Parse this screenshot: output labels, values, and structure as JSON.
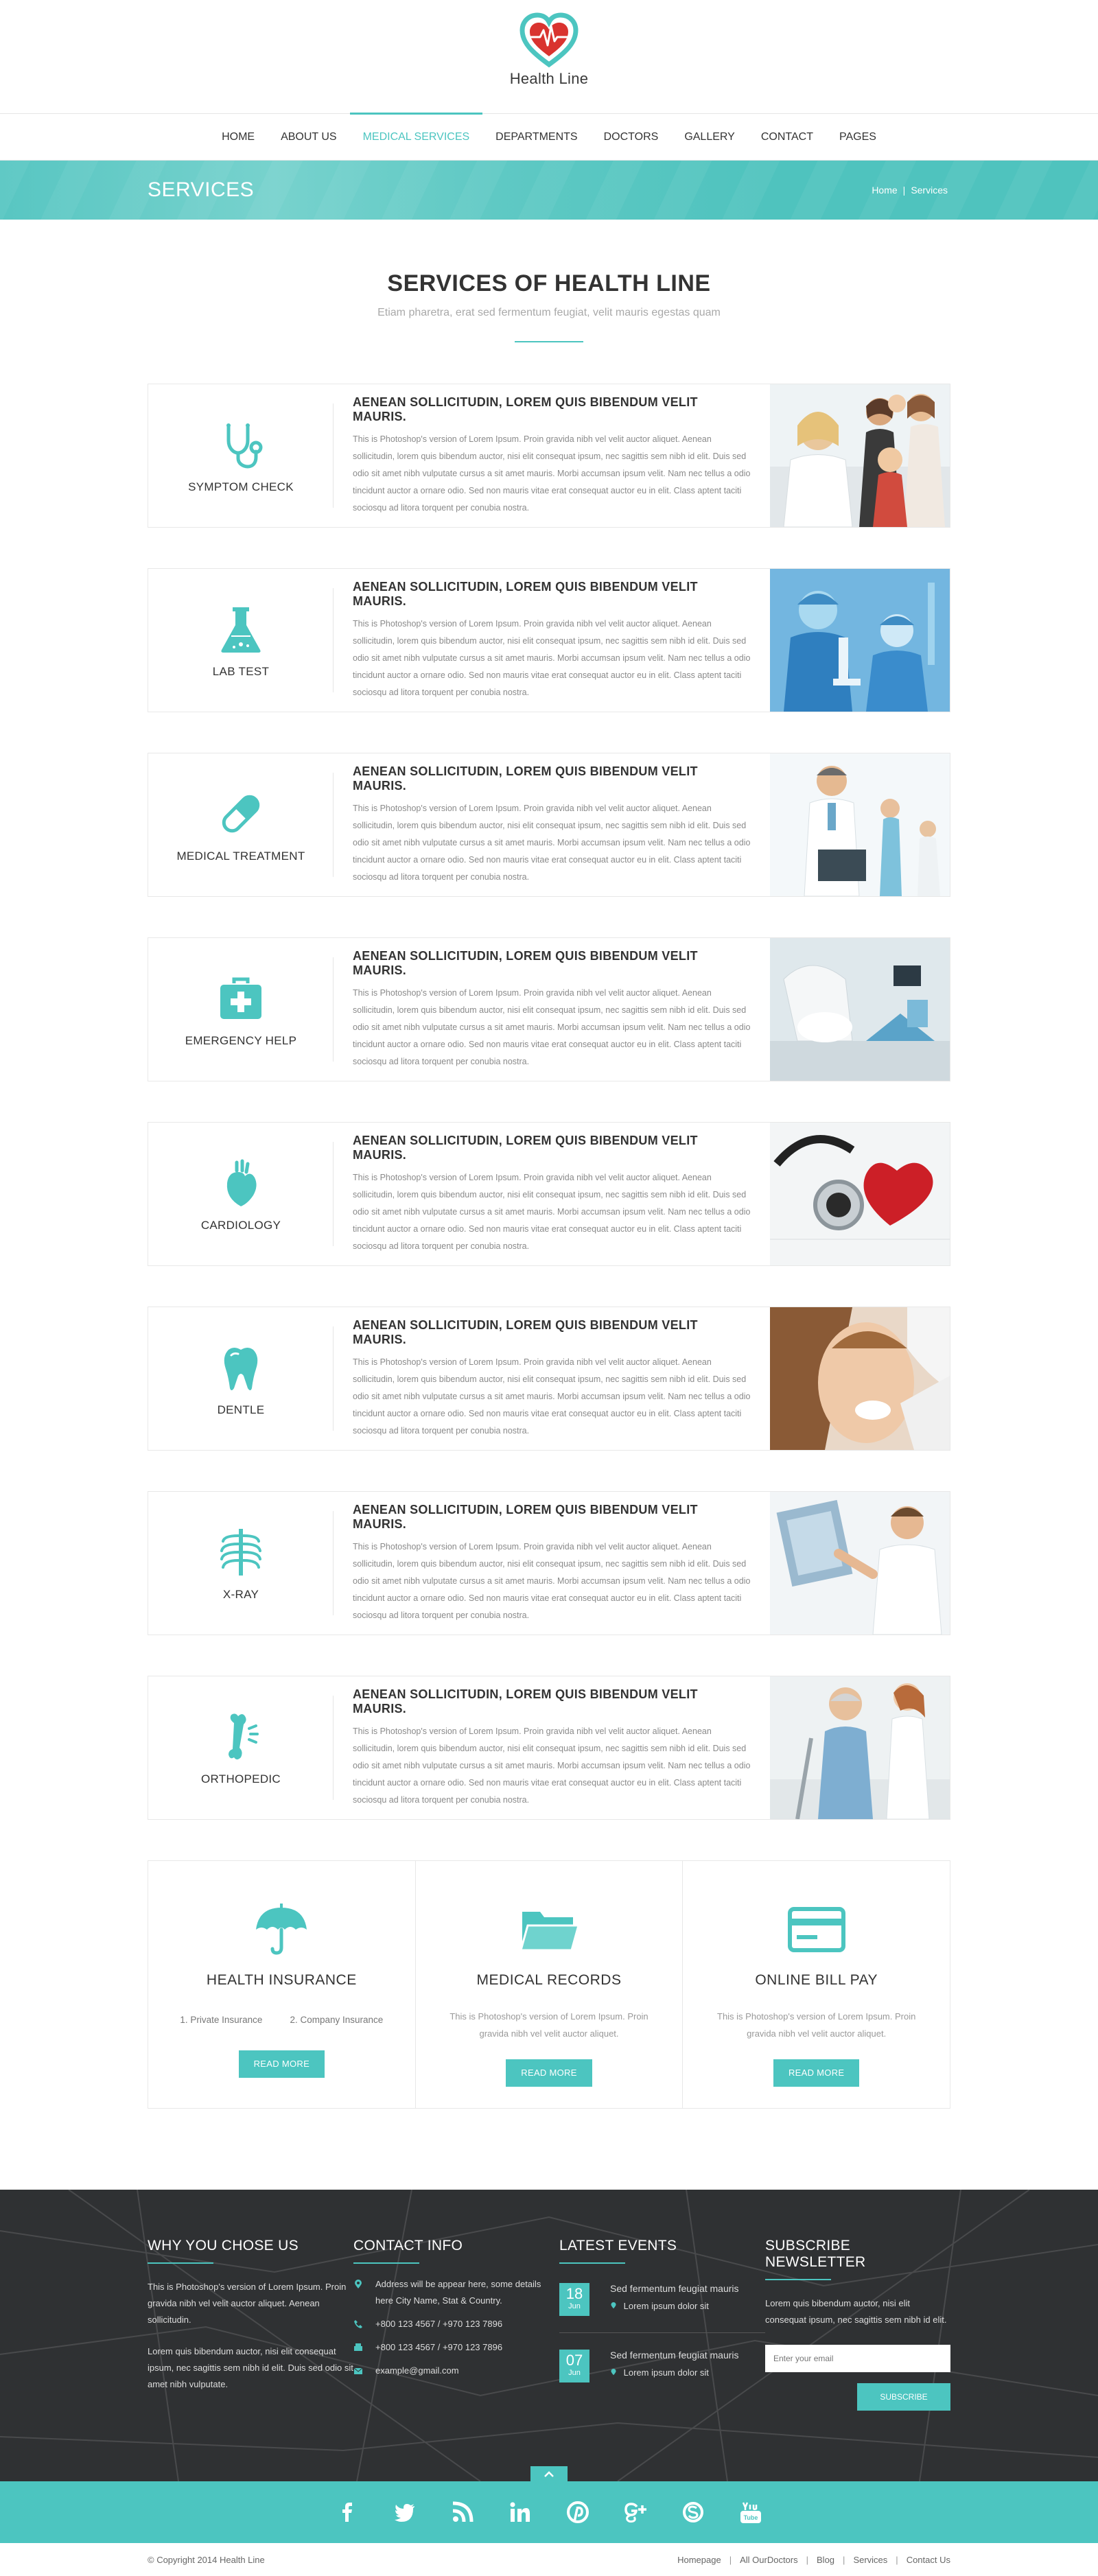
{
  "header": {
    "logo_text": "Health Line"
  },
  "nav": {
    "items": [
      {
        "label": "HOME"
      },
      {
        "label": "ABOUT US"
      },
      {
        "label": "MEDICAL SERVICES"
      },
      {
        "label": "DEPARTMENTS"
      },
      {
        "label": "DOCTORS"
      },
      {
        "label": "GALLERY"
      },
      {
        "label": "CONTACT"
      },
      {
        "label": "PAGES"
      }
    ],
    "active": "MEDICAL SERVICES"
  },
  "titlebar": {
    "title": "SERVICES",
    "crumb_home": "Home",
    "crumb_sep": "|",
    "crumb_current": "Services"
  },
  "section": {
    "title": "SERVICES OF HEALTH LINE",
    "subtitle": "Etiam pharetra, erat sed fermentum feugiat, velit mauris egestas quam"
  },
  "services": [
    {
      "label": "SYMPTOM CHECK",
      "icon": "stethoscope-icon",
      "title": "AENEAN SOLLICITUDIN, LOREM QUIS BIBENDUM VELIT MAURIS.",
      "text": "This is Photoshop's version  of Lorem Ipsum. Proin gravida nibh vel velit auctor aliquet. Aenean sollicitudin, lorem quis bibendum auctor, nisi elit consequat ipsum, nec sagittis sem nibh id elit. Duis sed odio sit amet nibh vulputate cursus a sit amet mauris. Morbi accumsan ipsum velit. Nam nec tellus a odio tincidunt auctor a ornare odio. Sed non  mauris vitae erat consequat auctor eu in elit. Class aptent taciti sociosqu ad litora torquent per conubia nostra."
    },
    {
      "label": "LAB TEST",
      "icon": "flask-icon",
      "title": "AENEAN SOLLICITUDIN, LOREM QUIS BIBENDUM VELIT MAURIS.",
      "text": "This is Photoshop's version  of Lorem Ipsum. Proin gravida nibh vel velit auctor aliquet. Aenean sollicitudin, lorem quis bibendum auctor, nisi elit consequat ipsum, nec sagittis sem nibh id elit. Duis sed odio sit amet nibh vulputate cursus a sit amet mauris. Morbi accumsan ipsum velit. Nam nec tellus a odio tincidunt auctor a ornare odio. Sed non  mauris vitae erat consequat auctor eu in elit. Class aptent taciti sociosqu ad litora torquent per conubia nostra."
    },
    {
      "label": "MEDICAL TREATMENT",
      "icon": "pill-icon",
      "title": "AENEAN SOLLICITUDIN, LOREM QUIS BIBENDUM VELIT MAURIS.",
      "text": "This is Photoshop's version  of Lorem Ipsum. Proin gravida nibh vel velit auctor aliquet. Aenean sollicitudin, lorem quis bibendum auctor, nisi elit consequat ipsum, nec sagittis sem nibh id elit. Duis sed odio sit amet nibh vulputate cursus a sit amet mauris. Morbi accumsan ipsum velit. Nam nec tellus a odio tincidunt auctor a ornare odio. Sed non  mauris vitae erat consequat auctor eu in elit. Class aptent taciti sociosqu ad litora torquent per conubia nostra."
    },
    {
      "label": "EMERGENCY HELP",
      "icon": "first-aid-kit-icon",
      "title": "AENEAN SOLLICITUDIN, LOREM QUIS BIBENDUM VELIT MAURIS.",
      "text": "This is Photoshop's version  of Lorem Ipsum. Proin gravida nibh vel velit auctor aliquet. Aenean sollicitudin, lorem quis bibendum auctor, nisi elit consequat ipsum, nec sagittis sem nibh id elit. Duis sed odio sit amet nibh vulputate cursus a sit amet mauris. Morbi accumsan ipsum velit. Nam nec tellus a odio tincidunt auctor a ornare odio. Sed non  mauris vitae erat consequat auctor eu in elit. Class aptent taciti sociosqu ad litora torquent per conubia nostra."
    },
    {
      "label": "CARDIOLOGY",
      "icon": "heart-organ-icon",
      "title": "AENEAN SOLLICITUDIN, LOREM QUIS BIBENDUM VELIT MAURIS.",
      "text": "This is Photoshop's version  of Lorem Ipsum. Proin gravida nibh vel velit auctor aliquet. Aenean sollicitudin, lorem quis bibendum auctor, nisi elit consequat ipsum, nec sagittis sem nibh id elit. Duis sed odio sit amet nibh vulputate cursus a sit amet mauris. Morbi accumsan ipsum velit. Nam nec tellus a odio tincidunt auctor a ornare odio. Sed non  mauris vitae erat consequat auctor eu in elit. Class aptent taciti sociosqu ad litora torquent per conubia nostra."
    },
    {
      "label": "DENTLE",
      "icon": "tooth-icon",
      "title": "AENEAN SOLLICITUDIN, LOREM QUIS BIBENDUM VELIT MAURIS.",
      "text": "This is Photoshop's version  of Lorem Ipsum. Proin gravida nibh vel velit auctor aliquet. Aenean sollicitudin, lorem quis bibendum auctor, nisi elit consequat ipsum, nec sagittis sem nibh id elit. Duis sed odio sit amet nibh vulputate cursus a sit amet mauris. Morbi accumsan ipsum velit. Nam nec tellus a odio tincidunt auctor a ornare odio. Sed non  mauris vitae erat consequat auctor eu in elit. Class aptent taciti sociosqu ad litora torquent per conubia nostra."
    },
    {
      "label": "X-RAY",
      "icon": "ribcage-icon",
      "title": "AENEAN SOLLICITUDIN, LOREM QUIS BIBENDUM VELIT MAURIS.",
      "text": "This is Photoshop's version  of Lorem Ipsum. Proin gravida nibh vel velit auctor aliquet. Aenean sollicitudin, lorem quis bibendum auctor, nisi elit consequat ipsum, nec sagittis sem nibh id elit. Duis sed odio sit amet nibh vulputate cursus a sit amet mauris. Morbi accumsan ipsum velit. Nam nec tellus a odio tincidunt auctor a ornare odio. Sed non  mauris vitae erat consequat auctor eu in elit. Class aptent taciti sociosqu ad litora torquent per conubia nostra."
    },
    {
      "label": "ORTHOPEDIC",
      "icon": "bone-icon",
      "title": "AENEAN SOLLICITUDIN, LOREM QUIS BIBENDUM VELIT MAURIS.",
      "text": "This is Photoshop's version  of Lorem Ipsum. Proin gravida nibh vel velit auctor aliquet. Aenean sollicitudin, lorem quis bibendum auctor, nisi elit consequat ipsum, nec sagittis sem nibh id elit. Duis sed odio sit amet nibh vulputate cursus a sit amet mauris. Morbi accumsan ipsum velit. Nam nec tellus a odio tincidunt auctor a ornare odio. Sed non  mauris vitae erat consequat auctor eu in elit. Class aptent taciti sociosqu ad litora torquent per conubia nostra."
    }
  ],
  "features": [
    {
      "title": "HEALTH INSURANCE",
      "icon": "umbrella-icon",
      "list": [
        "1. Private Insurance",
        "2. Company Insurance"
      ],
      "button": "READ MORE"
    },
    {
      "title": "MEDICAL RECORDS",
      "icon": "folder-icon",
      "text": "This is Photoshop's version  of Lorem Ipsum. Proin gravida nibh vel velit auctor aliquet.",
      "button": "READ MORE"
    },
    {
      "title": "ONLINE BILL PAY",
      "icon": "credit-card-icon",
      "text": "This is Photoshop's version  of Lorem Ipsum. Proin gravida nibh vel velit auctor aliquet.",
      "button": "READ MORE"
    }
  ],
  "footer": {
    "why": {
      "title": "WHY YOU CHOSE US",
      "p1": "This is Photoshop's version  of Lorem Ipsum. Proin gravida nibh vel velit auctor aliquet. Aenean sollicitudin.",
      "p2": "Lorem quis bibendum auctor, nisi elit consequat ipsum, nec sagittis sem nibh id elit. Duis sed odio sit amet nibh vulputate."
    },
    "contact": {
      "title": "CONTACT INFO",
      "address": "Address will be appear here, some details here City Name, Stat & Country.",
      "phone1": "+800 123 4567  /  +970 123 7896",
      "phone2": "+800 123 4567  /  +970 123 7896",
      "email": "example@gmail.com"
    },
    "events": {
      "title": "LATEST EVENTS",
      "items": [
        {
          "day": "18",
          "month": "Jun",
          "title": "Sed fermentum feugiat mauris",
          "sub": "Lorem ipsum dolor sit"
        },
        {
          "day": "07",
          "month": "Jun",
          "title": "Sed fermentum feugiat mauris",
          "sub": "Lorem ipsum dolor sit"
        }
      ]
    },
    "newsletter": {
      "title": "SUBSCRIBE NEWSLETTER",
      "text": "Lorem quis bibendum auctor, nisi elit consequat ipsum, nec sagittis sem nibh id elit.",
      "placeholder": "Enter your email",
      "button": "SUBSCRIBE"
    },
    "social": [
      "facebook-icon",
      "twitter-icon",
      "rss-icon",
      "linkedin-icon",
      "pinterest-icon",
      "google-plus-icon",
      "skype-icon",
      "youtube-icon"
    ],
    "copyright": "© Copyright 2014 Health Line",
    "links": [
      "Homepage",
      "All OurDoctors",
      "Blog",
      "Services",
      "Contact Us"
    ]
  },
  "colors": {
    "accent": "#4cc5c0",
    "logo_red": "#d9332f",
    "footer_bg": "#2f3133"
  }
}
